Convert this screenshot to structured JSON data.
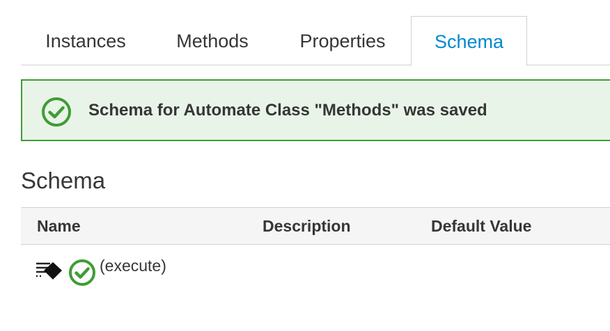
{
  "tabs": {
    "instances": "Instances",
    "methods": "Methods",
    "properties": "Properties",
    "schema": "Schema",
    "active": "Schema"
  },
  "alert": {
    "type": "success",
    "icon": "check-circle-icon",
    "message": "Schema for Automate Class \"Methods\" was saved"
  },
  "section": {
    "title": "Schema"
  },
  "table": {
    "columns": {
      "name": "Name",
      "description": "Description",
      "default_value": "Default Value"
    },
    "rows": [
      {
        "type_icon": "method-execute-icon",
        "status_icon": "check-circle-icon",
        "name": "(execute)",
        "description": "",
        "default_value": ""
      }
    ]
  },
  "colors": {
    "accent": "#0088ce",
    "success": "#3f9c35",
    "success_bg": "#e9f4e9",
    "header_bg": "#f5f5f5",
    "text": "#363636"
  }
}
